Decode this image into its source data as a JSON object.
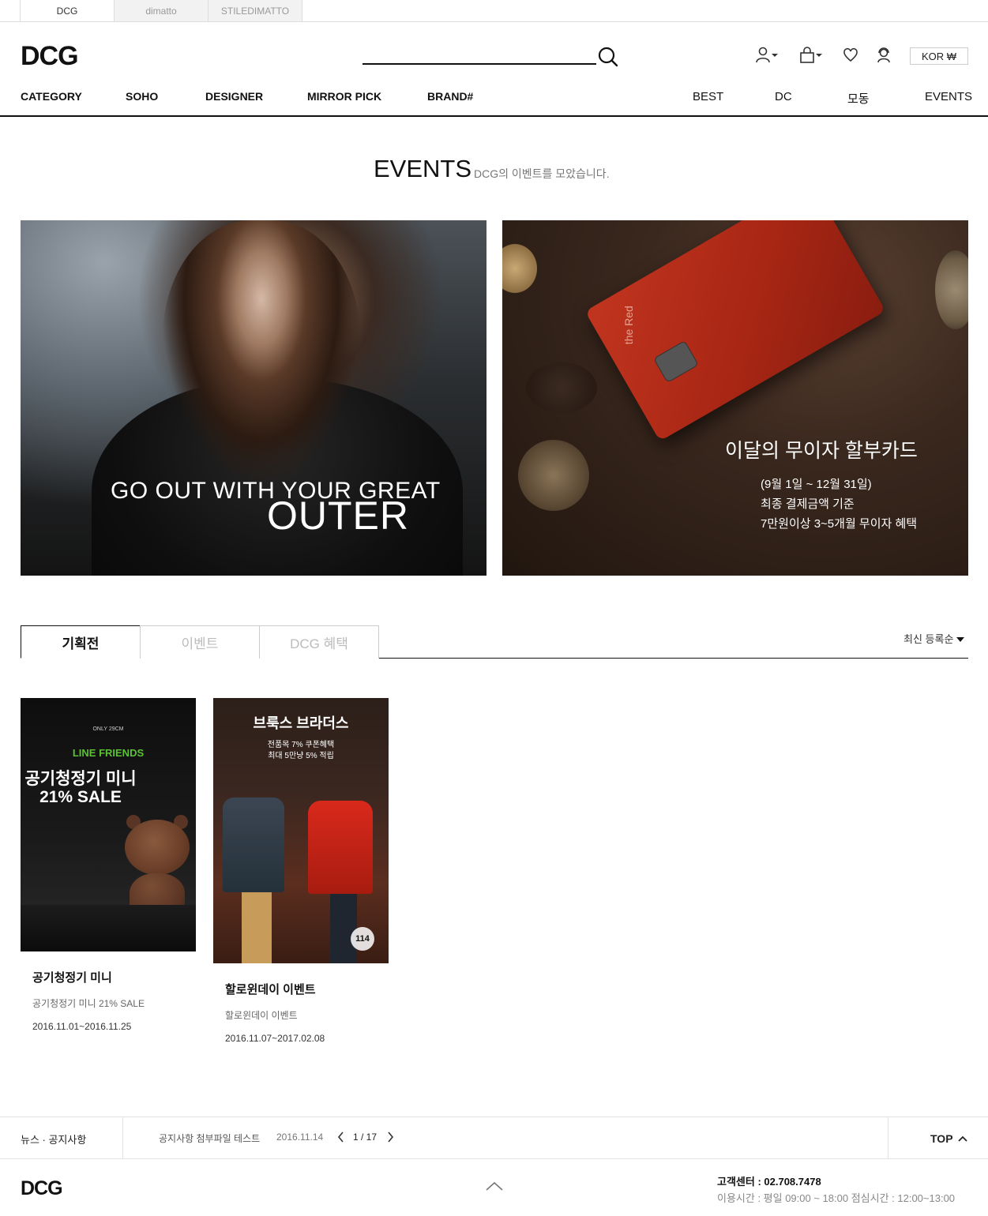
{
  "site_tabs": [
    {
      "label": "DCG",
      "active": true
    },
    {
      "label": "dimatto",
      "active": false
    },
    {
      "label": "STILEDIMATTO",
      "active": false
    }
  ],
  "header": {
    "logo": "DCG",
    "search_placeholder": "",
    "language": "KOR ₩"
  },
  "gnb": {
    "left": [
      "CATEGORY",
      "SOHO",
      "DESIGNER",
      "MIRROR PICK",
      "BRAND#"
    ],
    "right": [
      "BEST",
      "DC",
      "모동",
      "EVENTS"
    ]
  },
  "page": {
    "title": "EVENTS",
    "subtitle": "DCG의 이벤트를 모았습니다."
  },
  "banners": {
    "left": {
      "line1": "GO OUT WITH YOUR GREAT",
      "line2": "OUTER"
    },
    "right": {
      "card_brand": "the Red",
      "title": "이달의 무이자 할부카드",
      "lines": [
        "(9월 1일 ~ 12월 31일)",
        "최종 결제금액 기준",
        "7만원이상 3~5개월 무이자 혜택"
      ]
    }
  },
  "category_tabs": [
    {
      "label": "기획전",
      "active": true
    },
    {
      "label": "이벤트",
      "active": false
    },
    {
      "label": "DCG 혜택",
      "active": false
    }
  ],
  "sort": {
    "label": "최신 등록순"
  },
  "products": [
    {
      "img_top": "ONLY 29CM",
      "img_brand": "LINE FRIENDS",
      "img_title": "공기청정기 미니",
      "img_sale": "21% SALE",
      "title": "공기청정기 미니",
      "desc": "공기청정기 미니 21% SALE",
      "date": "2016.11.01~2016.11.25"
    },
    {
      "img_title": "브룩스 브라더스",
      "img_sub1": "전품목 7% 쿠폰혜택",
      "img_sub2": "최대 5만냥 5% 적립",
      "img_badge": "114",
      "title": "할로윈데이 이벤트",
      "desc": "할로윈데이 이벤트",
      "date": "2016.11.07~2017.02.08"
    }
  ],
  "notice": {
    "label": "뉴스 · 공지사항",
    "text": "공지사항 첨부파일 테스트",
    "date": "2016.11.14",
    "page": "1 / 17",
    "top_label": "TOP"
  },
  "footer": {
    "logo": "DCG",
    "cs_label": "고객센터 : 02.708.7478",
    "hours": "이용시간 : 평일 09:00 ~ 18:00 점심시간 : 12:00~13:00"
  },
  "colors": {
    "accent": "#111111",
    "card_red": "#b02a18",
    "line_friends_green": "#5bc236",
    "tab_inactive": "#bbbbbb"
  }
}
